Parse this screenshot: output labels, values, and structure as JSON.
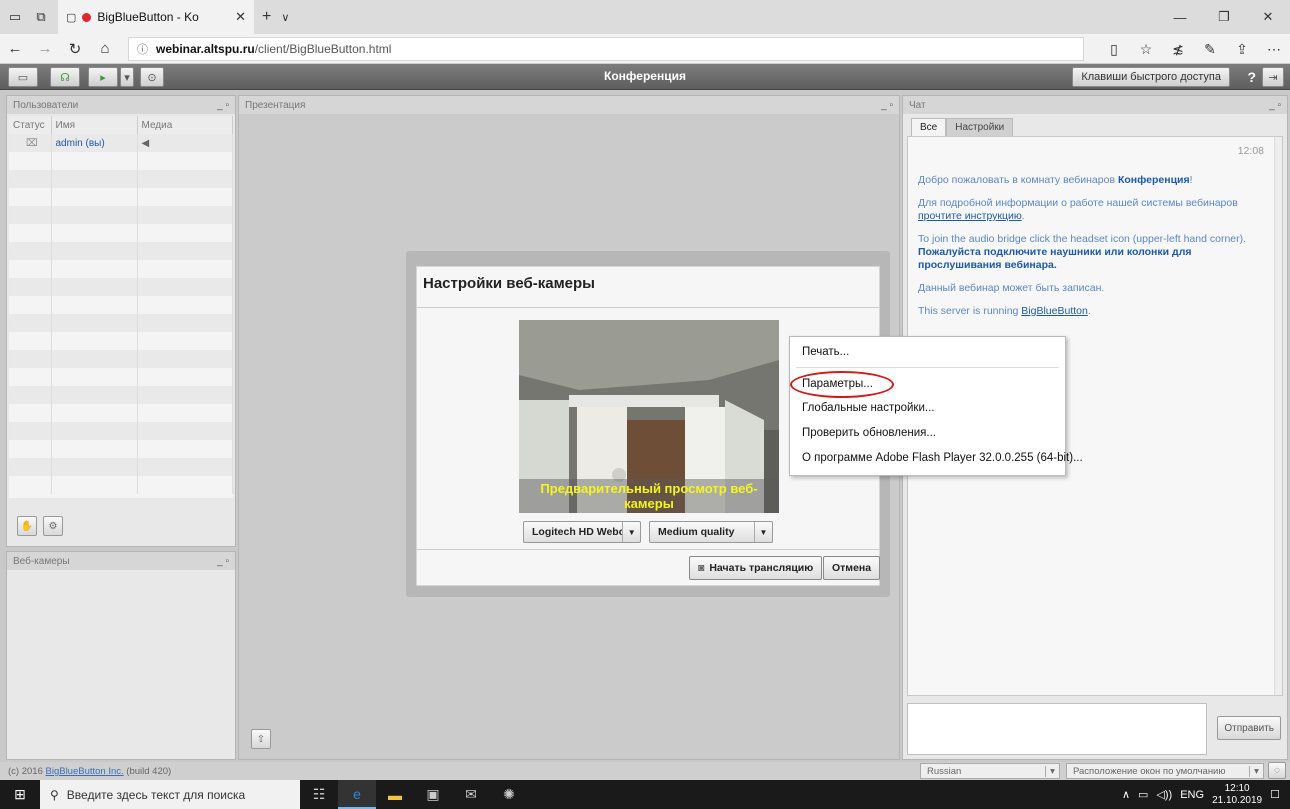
{
  "browser": {
    "tab_title": "BigBlueButton - Ko",
    "url_host": "webinar.altspu.ru",
    "url_path": "/client/BigBlueButton.html"
  },
  "bbb": {
    "title": "Конференция",
    "shortcut_label": "Клавиши быстрого доступа",
    "help_label": "?"
  },
  "users": {
    "title": "Пользователи",
    "col_status": "Статус",
    "col_name": "Имя",
    "col_media": "Медиа",
    "rows": [
      {
        "name": "admin (вы)"
      }
    ]
  },
  "webcams": {
    "title": "Веб-камеры"
  },
  "presentation": {
    "title": "Презентация"
  },
  "chat": {
    "title": "Чат",
    "tab_all": "Все",
    "tab_settings": "Настройки",
    "time": "12:08",
    "welcome_prefix": "Добро пожаловать в комнату вебинаров ",
    "welcome_room": "Конференция",
    "welcome_suffix": "!",
    "info_text": "Для подробной информации о работе нашей системы вебинаров ",
    "info_link": "прочтите инструкцию",
    "info_end": ".",
    "audio_text": "To join the audio bridge click the headset icon (upper-left hand corner).",
    "audio_bold": "Пожалуйста подключите наушники или колонки для прослушивания вебинара.",
    "record_text": "Данный вебинар может быть записан.",
    "server_text": "This server is running ",
    "server_link": "BigBlueButton",
    "server_end": ".",
    "send_label": "Отправить"
  },
  "footer": {
    "copyright": "(c) 2016 ",
    "company": "BigBlueButton Inc.",
    "build": " (build 420)",
    "language": "Russian",
    "layout": "Расположение окон по умолчанию"
  },
  "webcam_dialog": {
    "title": "Настройки веб-камеры",
    "preview_caption": "Предварительный просмотр веб-камеры",
    "camera_select": "Logitech HD Webc",
    "quality_select": "Medium quality",
    "start_label": "Начать трансляцию",
    "cancel_label": "Отмена"
  },
  "context_menu": {
    "items": [
      "Печать...",
      "Параметры...",
      "Глобальные настройки...",
      "Проверить обновления...",
      "О программе Adobe Flash Player 32.0.0.255 (64-bit)..."
    ]
  },
  "taskbar": {
    "search_placeholder": "Введите здесь текст для поиска",
    "lang": "ENG",
    "time": "12:10",
    "date": "21.10.2019"
  }
}
